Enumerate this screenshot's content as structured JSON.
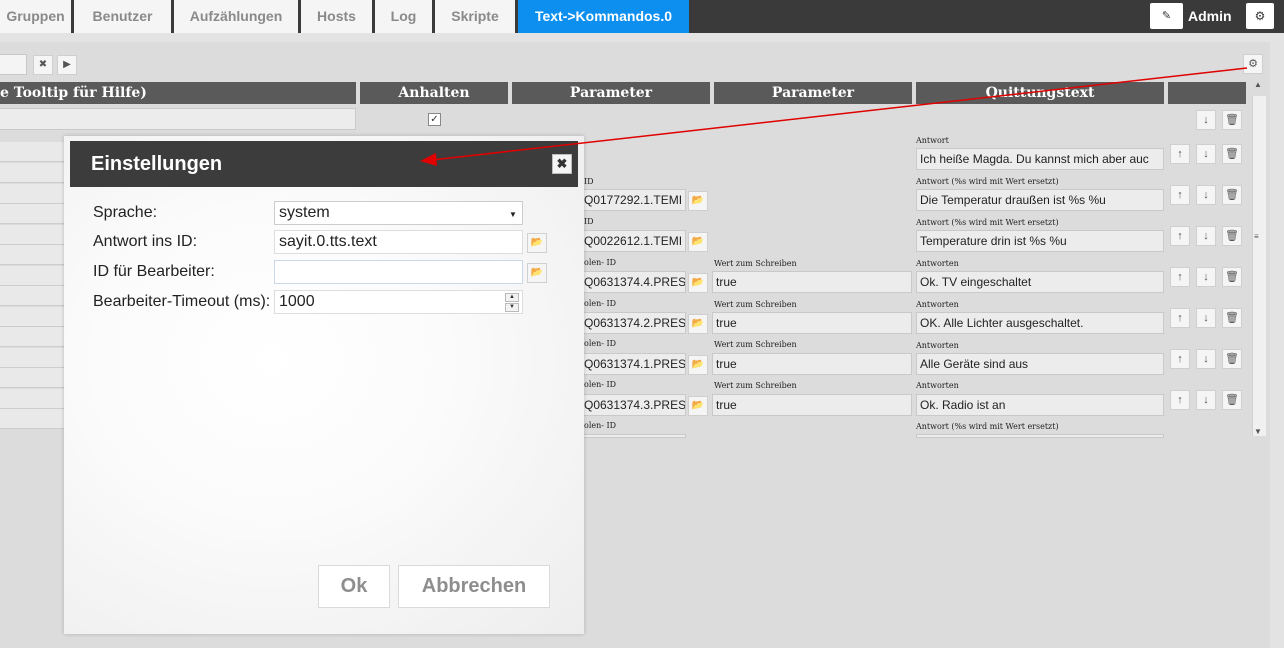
{
  "tabs": [
    {
      "label": "Gruppen",
      "active": false
    },
    {
      "label": "Benutzer",
      "active": false
    },
    {
      "label": "Aufzählungen",
      "active": false
    },
    {
      "label": "Hosts",
      "active": false
    },
    {
      "label": "Log",
      "active": false
    },
    {
      "label": "Skripte",
      "active": false
    },
    {
      "label": "Text->Kommandos.0",
      "active": true
    }
  ],
  "user": {
    "name": "Admin",
    "edit_icon": "pencil-icon",
    "settings_icon": "gear-icon"
  },
  "toolbar": {
    "clear_icon": "close-icon",
    "play_icon": "play-icon",
    "settings_icon": "gear-icon"
  },
  "table": {
    "headers": [
      "e Tooltip für Hilfe)",
      "Anhalten",
      "Parameter",
      "Parameter",
      "Quittungstext"
    ],
    "row0": {
      "checked": true
    },
    "rows": [
      {
        "id_label": "",
        "id_value": "",
        "write_label": "",
        "write_value": "",
        "answer_label": "Antwort",
        "answer_value": "Ich heiße Magda. Du kannst mich aber auc"
      },
      {
        "id_label": "ID",
        "id_value": "Q0177292.1.TEMI",
        "write_label": "",
        "write_value": "",
        "answer_label": "Antwort (%s wird mit Wert ersetzt)",
        "answer_value": "Die Temperatur draußen ist %s %u"
      },
      {
        "id_label": "ID",
        "id_value": "Q0022612.1.TEMI",
        "write_label": "",
        "write_value": "",
        "answer_label": "Antwort (%s wird mit Wert ersetzt)",
        "answer_value": "Temperature drin ist %s %u"
      },
      {
        "id_label": "olen- ID",
        "id_value": "Q0631374.4.PRES",
        "write_label": "Wert zum Schreiben",
        "write_value": "true",
        "answer_label": "Antworten",
        "answer_value": "Ok. TV eingeschaltet"
      },
      {
        "id_label": "olen- ID",
        "id_value": "Q0631374.2.PRES",
        "write_label": "Wert zum Schreiben",
        "write_value": "true",
        "answer_label": "Antworten",
        "answer_value": "OK. Alle Lichter ausgeschaltet."
      },
      {
        "id_label": "olen- ID",
        "id_value": "Q0631374.1.PRES",
        "write_label": "Wert zum Schreiben",
        "write_value": "true",
        "answer_label": "Antworten",
        "answer_value": "Alle Geräte sind aus"
      },
      {
        "id_label": "olen- ID",
        "id_value": "Q0631374.3.PRES",
        "write_label": "Wert zum Schreiben",
        "write_value": "true",
        "answer_label": "Antworten",
        "answer_value": "Ok. Radio ist an"
      },
      {
        "id_label": "olen- ID",
        "id_value": "",
        "write_label": "",
        "write_value": "",
        "answer_label": "Antwort (%s wird mit Wert ersetzt)",
        "answer_value": ""
      }
    ],
    "row_actions": {
      "up_icon": "arrow-up-icon",
      "down_icon": "arrow-down-icon",
      "delete_icon": "trash-icon",
      "folder_icon": "folder-icon"
    }
  },
  "dialog": {
    "title": "Einstellungen",
    "close_icon": "close-icon",
    "fields": {
      "language_label": "Sprache:",
      "language_value": "system",
      "answer_id_label": "Antwort ins ID:",
      "answer_id_value": "sayit.0.tts.text",
      "processor_id_label": "ID für Bearbeiter:",
      "processor_id_value": "",
      "timeout_label": "Bearbeiter-Timeout (ms):",
      "timeout_value": "1000"
    },
    "ok_label": "Ok",
    "cancel_label": "Abbrechen"
  },
  "annotation": {
    "color": "#e00000"
  }
}
